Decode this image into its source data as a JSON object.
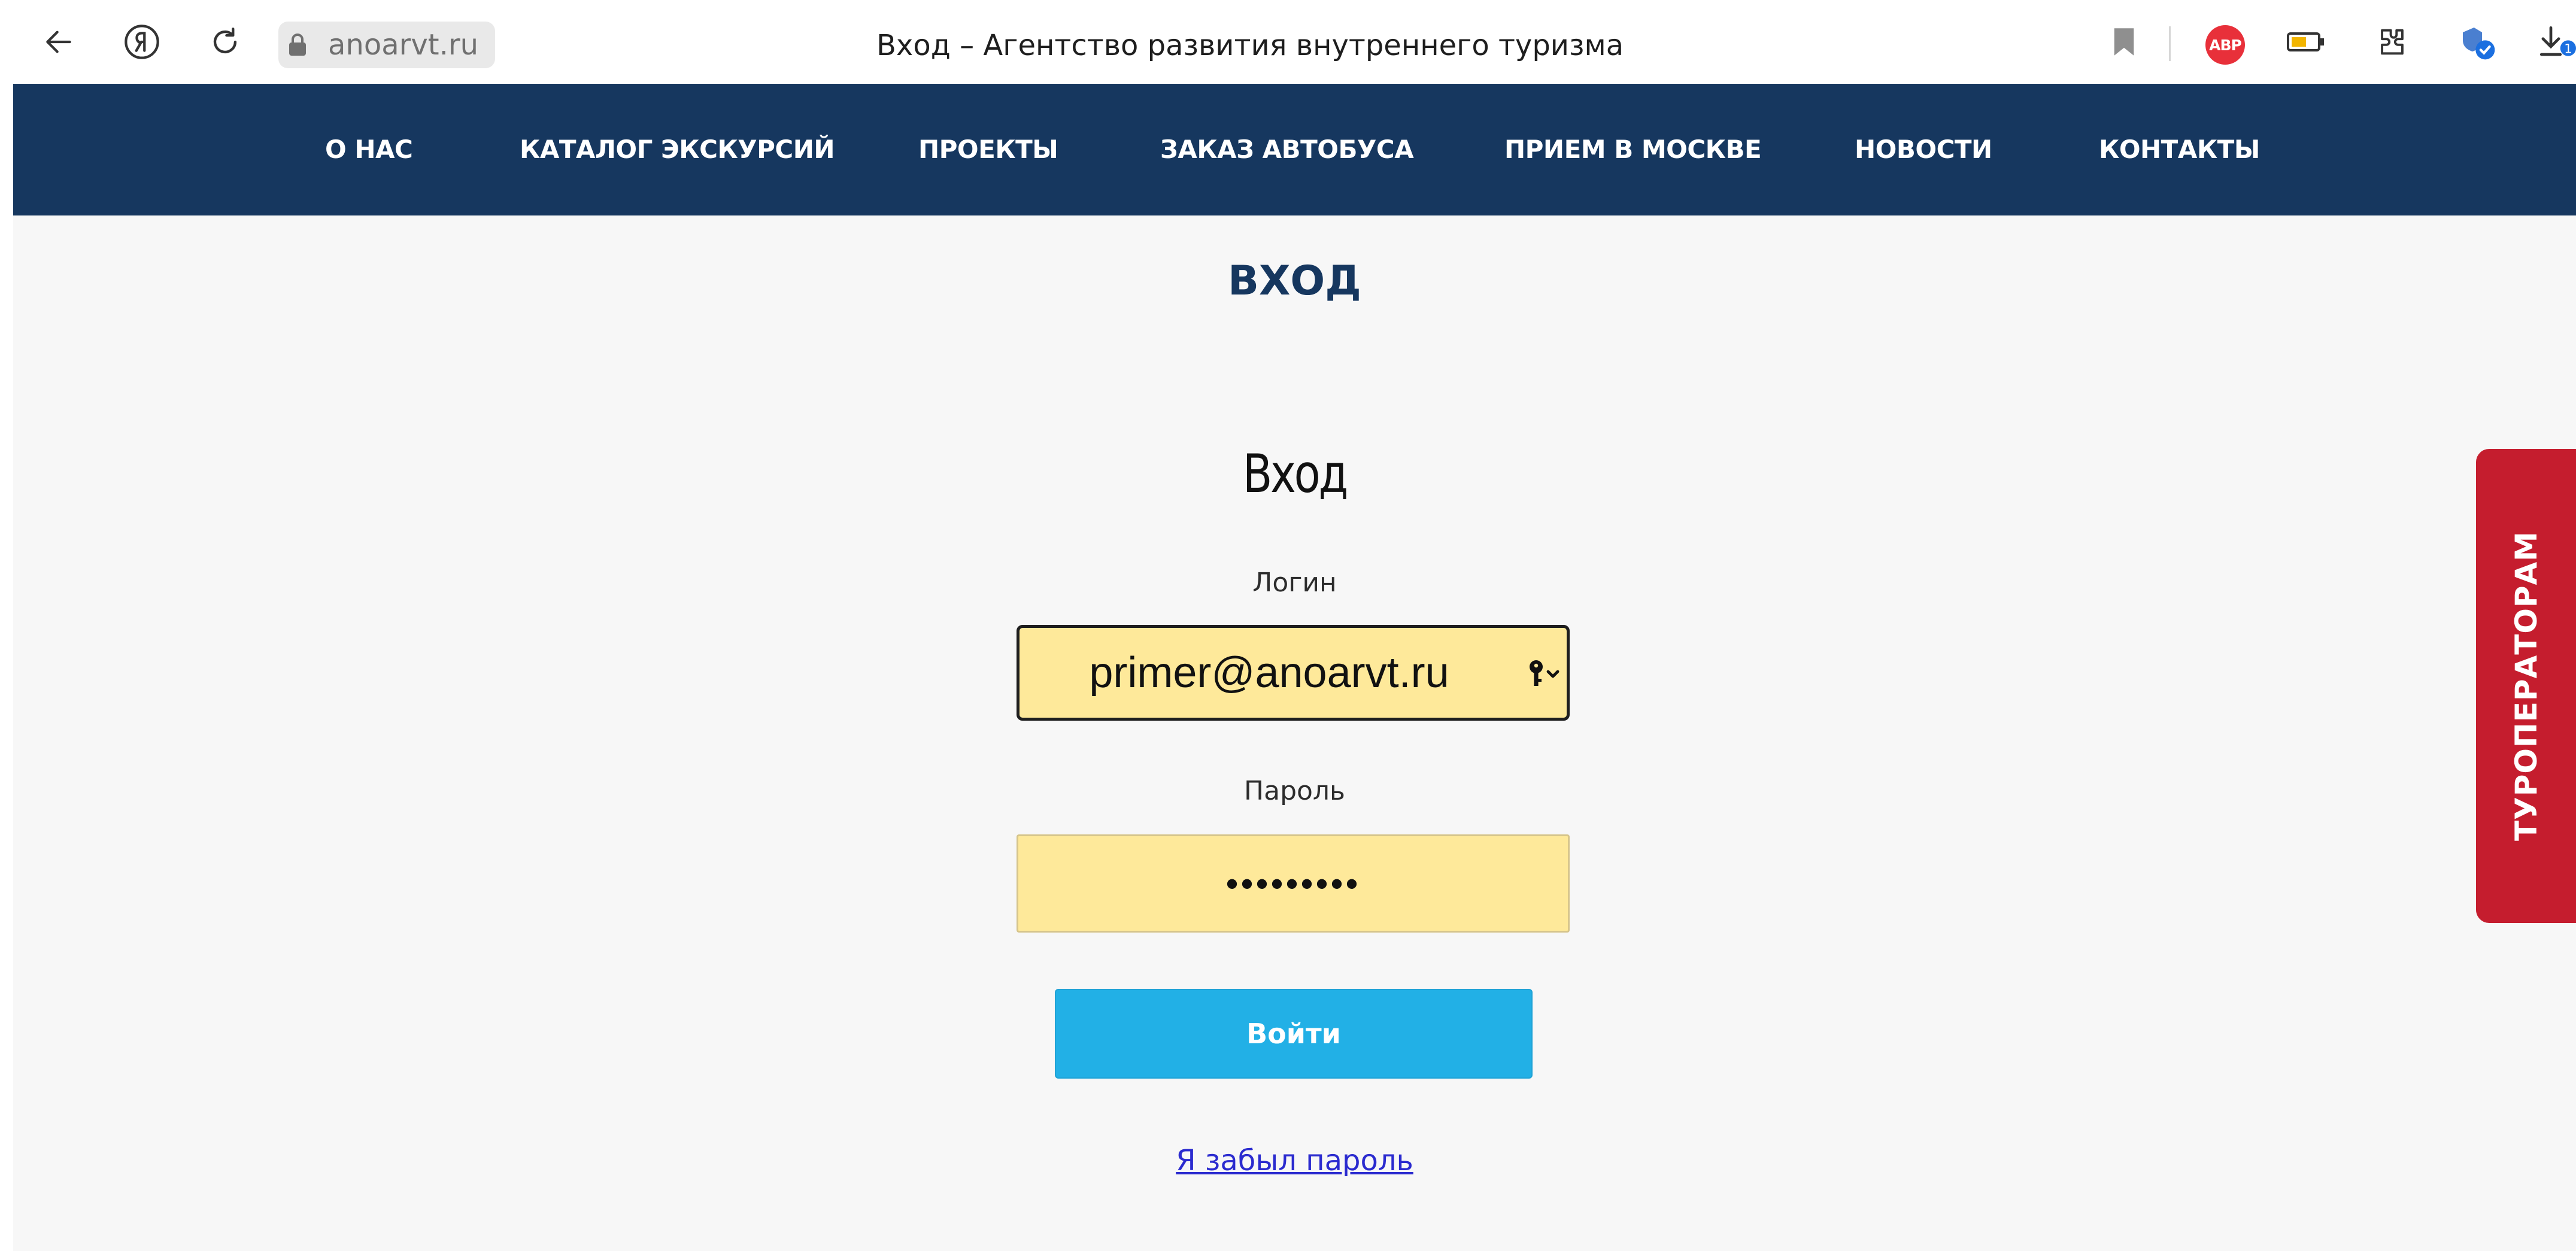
{
  "browser": {
    "domain": "anoarvt.ru",
    "tab_title": "Вход – Агентство развития внутреннего туризма",
    "adblock_label": "ABP",
    "download_badge": "1",
    "icons": [
      "back-arrow-icon",
      "yandex-icon",
      "reload-icon",
      "lock-icon",
      "bookmark-icon",
      "adblock-icon",
      "battery-icon",
      "extension-icon",
      "download-icon"
    ]
  },
  "nav": {
    "items": [
      {
        "label": "О НАС"
      },
      {
        "label": "КАТАЛОГ ЭКСКУРСИЙ"
      },
      {
        "label": "ПРОЕКТЫ"
      },
      {
        "label": "ЗАКАЗ АВТОБУСА"
      },
      {
        "label": "ПРИЕМ В МОСКВЕ"
      },
      {
        "label": "НОВОСТИ"
      },
      {
        "label": "КОНТАКТЫ"
      }
    ]
  },
  "page": {
    "heading": "ВХОД"
  },
  "form": {
    "title": "Вход",
    "login_label": "Логин",
    "login_value": "primer@anoarvt.ru",
    "password_label": "Пароль",
    "password_value": "•••••••••",
    "submit_label": "Войти",
    "forgot_link": "Я забыл пароль"
  },
  "side_tab": {
    "label": "ТУРОПЕРАТОРАМ"
  },
  "colors": {
    "nav_bg": "#16375f",
    "heading": "#16375f",
    "page_bg": "#f7f7f7",
    "autofill_bg": "#fee99a",
    "button_bg": "#22b0e6",
    "side_tab_bg": "#c51d2e",
    "link": "#2b2bcf"
  }
}
